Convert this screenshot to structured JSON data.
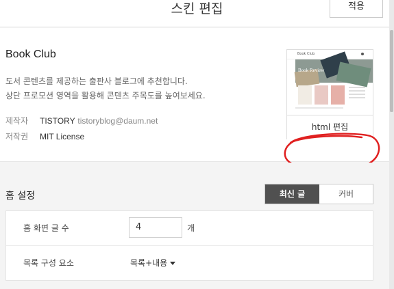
{
  "header": {
    "title": "스킨 편집",
    "apply_label": "적용"
  },
  "skin": {
    "name": "Book Club",
    "description_line1": "도서 콘텐츠를 제공하는 출판사 블로그에 추천합니다.",
    "description_line2": "상단 프로모션 영역을 활용해 콘텐츠 주목도를 높여보세요.",
    "maker_label": "제작자",
    "maker_name": "TISTORY",
    "maker_email": "tistoryblog@daum.net",
    "license_label": "저작권",
    "license_value": "MIT License",
    "thumbnail": {
      "site_title": "Book Club",
      "hero_text": "Book Review"
    },
    "html_edit_label": "html 편집"
  },
  "home_settings": {
    "title": "홈 설정",
    "tabs": [
      {
        "label": "최신 글",
        "active": true
      },
      {
        "label": "커버",
        "active": false
      }
    ],
    "rows": {
      "post_count_label": "홈 화면 글 수",
      "post_count_value": "4",
      "post_count_unit": "개",
      "list_layout_label": "목록 구성 요소",
      "list_layout_value": "목록+내용"
    }
  },
  "colors": {
    "active_tab": "#505050",
    "annotation": "#e02020"
  }
}
